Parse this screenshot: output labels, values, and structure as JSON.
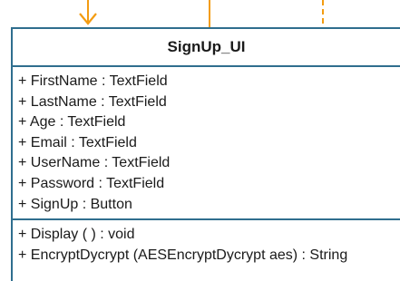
{
  "class_diagram": {
    "class_name": "SignUp_UI",
    "attributes": [
      "+ FirstName : TextField",
      "+ LastName : TextField",
      "+ Age : TextField",
      "+ Email : TextField",
      "+ UserName : TextField",
      "+ Password : TextField",
      "+ SignUp : Button"
    ],
    "operations": [
      "+ Display ( ) : void",
      "+ EncryptDycrypt (AESEncryptDycrypt aes) : String"
    ],
    "colors": {
      "border": "#2f6e8e",
      "connector": "#f39c12"
    }
  }
}
